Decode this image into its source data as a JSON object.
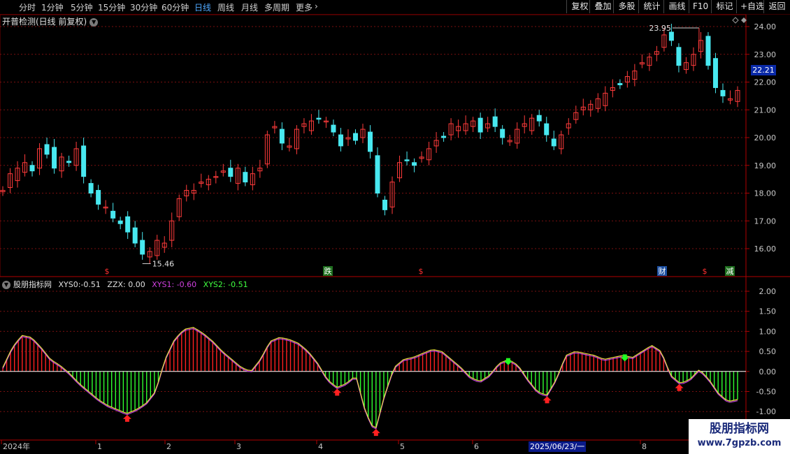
{
  "toolbar": {
    "periods": [
      {
        "label": "分时",
        "active": false
      },
      {
        "label": "1分钟",
        "active": false
      },
      {
        "label": "5分钟",
        "active": false
      },
      {
        "label": "15分钟",
        "active": false
      },
      {
        "label": "30分钟",
        "active": false
      },
      {
        "label": "60分钟",
        "active": false
      },
      {
        "label": "日线",
        "active": true
      },
      {
        "label": "周线",
        "active": false
      },
      {
        "label": "月线",
        "active": false
      },
      {
        "label": "多周期",
        "active": false
      },
      {
        "label": "更多",
        "active": false
      }
    ],
    "more_arrow": "›",
    "buttons": [
      "复权",
      "叠加",
      "多股",
      "统计",
      "画线",
      "F10",
      "标记",
      "+自选",
      "返回"
    ]
  },
  "main_chart": {
    "title": "开普检测(日线 前复权)",
    "price_axis": [
      "24.00",
      "23.00",
      "22.00",
      "21.00",
      "20.00",
      "19.00",
      "18.00",
      "17.00",
      "16.00"
    ],
    "current_price": "22.21",
    "high_label": "23.95",
    "low_label": "15.46",
    "markers": [
      {
        "text": "$",
        "color": "#ff3030",
        "bg": "none"
      },
      {
        "text": "跌",
        "color": "#ffffff",
        "bg": "#1e6e1e"
      },
      {
        "text": "$",
        "color": "#ff3030",
        "bg": "none"
      },
      {
        "text": "财",
        "color": "#ffffff",
        "bg": "#1c4fa0"
      },
      {
        "text": "$",
        "color": "#ff3030",
        "bg": "none"
      },
      {
        "text": "减",
        "color": "#ffffff",
        "bg": "#1e6e1e"
      }
    ],
    "colors": {
      "up": "#ff3b3b",
      "down": "#48e8f0",
      "grid": "#7a1010"
    }
  },
  "indicator": {
    "title": "股朋指标网",
    "values": [
      {
        "label": "XYS0:",
        "value": "-0.51",
        "color": "#e0e0e0"
      },
      {
        "label": "ZZX:",
        "value": "0.00",
        "color": "#e0e0e0"
      },
      {
        "label": "XYS1:",
        "value": "-0.60",
        "color": "#d040e0"
      },
      {
        "label": "XYS2:",
        "value": "-0.51",
        "color": "#40ff40"
      }
    ],
    "axis": [
      "2.00",
      "1.50",
      "1.00",
      "0.50",
      "0.00",
      "-0.50",
      "-1.00"
    ]
  },
  "x_axis": {
    "labels": [
      "2024年",
      "1",
      "2",
      "3",
      "4",
      "5",
      "6",
      "7",
      "8"
    ],
    "cursor_date": "2025/06/23/一"
  },
  "watermark": {
    "line1": "股朋指标网",
    "line2": "www.7gpzb.com"
  },
  "chart_data": [
    {
      "type": "candlestick",
      "title": "开普检测(日线 前复权)",
      "ylim": [
        15.1,
        24.3
      ],
      "annotations": [
        {
          "text": "23.95",
          "kind": "high"
        },
        {
          "text": "15.46",
          "kind": "low"
        }
      ],
      "close_path": [
        18.1,
        18.7,
        18.9,
        19.1,
        18.8,
        19.6,
        19.4,
        18.9,
        19.3,
        19.1,
        19.6,
        18.6,
        18.0,
        17.6,
        17.5,
        17.1,
        16.9,
        16.6,
        16.2,
        15.8,
        15.9,
        16.3,
        16.2,
        17.0,
        17.8,
        18.1,
        18.1,
        18.4,
        18.5,
        18.6,
        18.8,
        18.6,
        18.9,
        18.4,
        18.7,
        18.9,
        20.1,
        20.4,
        19.8,
        19.7,
        20.3,
        20.5,
        20.6,
        20.7,
        20.6,
        20.2,
        19.7,
        20.0,
        19.9,
        20.3,
        19.5,
        18.0,
        17.4,
        18.4,
        19.1,
        19.2,
        19.0,
        19.3,
        19.6,
        19.9,
        20.0,
        20.5,
        20.4,
        20.5,
        20.6,
        20.2,
        20.5,
        20.4,
        20.0,
        19.9,
        20.3,
        20.5,
        20.7,
        20.6,
        20.1,
        19.7,
        20.1,
        20.5,
        20.9,
        21.1,
        21.2,
        21.4,
        21.6,
        21.8,
        21.9,
        22.2,
        22.4,
        22.7,
        22.9,
        23.1,
        23.7,
        23.5,
        22.6,
        22.7,
        23.0,
        23.5,
        22.6,
        21.8,
        21.5,
        21.4,
        21.7
      ],
      "oscillator": {
        "type": "histogram",
        "ylim": [
          -1.2,
          2.2
        ],
        "series": [
          {
            "name": "XYS0"
          },
          {
            "name": "XYS1"
          },
          {
            "name": "XYS2"
          }
        ],
        "values": [
          0.1,
          0.6,
          0.9,
          0.85,
          0.6,
          0.3,
          0.15,
          -0.05,
          -0.3,
          -0.5,
          -0.7,
          -0.85,
          -0.95,
          -1.05,
          -0.95,
          -0.8,
          -0.5,
          0.3,
          0.8,
          1.05,
          1.1,
          0.95,
          0.75,
          0.5,
          0.3,
          0.1,
          0.0,
          0.3,
          0.75,
          0.85,
          0.8,
          0.7,
          0.5,
          0.2,
          -0.2,
          -0.4,
          -0.3,
          -0.1,
          -1.0,
          -1.5,
          -0.6,
          0.1,
          0.3,
          0.35,
          0.45,
          0.55,
          0.5,
          0.3,
          0.1,
          -0.15,
          -0.25,
          -0.1,
          0.2,
          0.3,
          0.15,
          -0.2,
          -0.5,
          -0.6,
          -0.2,
          0.4,
          0.5,
          0.45,
          0.4,
          0.3,
          0.35,
          0.4,
          0.35,
          0.5,
          0.65,
          0.5,
          -0.1,
          -0.3,
          -0.2,
          0.05,
          -0.2,
          -0.55,
          -0.75,
          -0.7
        ]
      }
    }
  ]
}
